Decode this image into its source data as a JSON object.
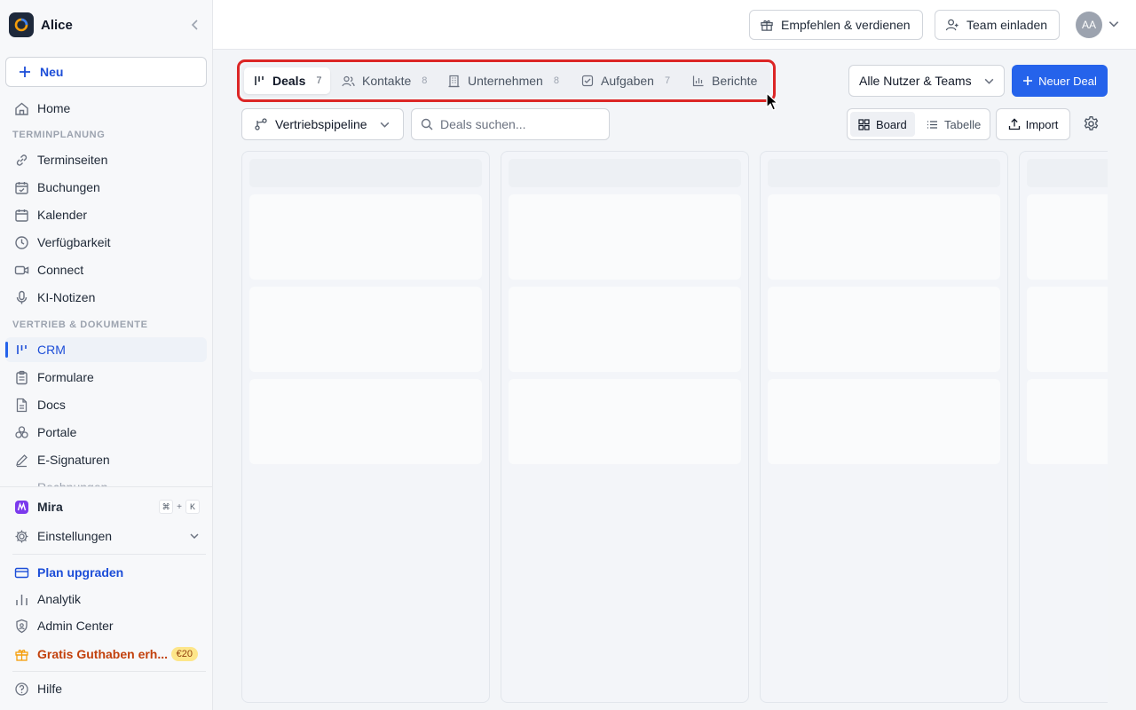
{
  "workspace": {
    "name": "Alice"
  },
  "sidebar": {
    "new_label": "Neu",
    "home": "Home",
    "section_scheduling": "TERMINPLANUNG",
    "scheduling_items": [
      "Terminseiten",
      "Buchungen",
      "Kalender",
      "Verfügbarkeit",
      "Connect",
      "KI-Notizen"
    ],
    "section_sales": "VERTRIEB & DOKUMENTE",
    "sales_items": [
      "CRM",
      "Formulare",
      "Docs",
      "Portale",
      "E-Signaturen"
    ],
    "cut_item": "Rechnungen",
    "mira": "Mira",
    "shortcut_cmd": "⌘",
    "shortcut_plus": "+",
    "shortcut_key": "K",
    "settings": "Einstellungen",
    "upgrade": "Plan upgraden",
    "analytics": "Analytik",
    "admin": "Admin Center",
    "credit": "Gratis Guthaben erh...",
    "credit_badge": "€20",
    "help": "Hilfe"
  },
  "topbar": {
    "refer": "Empfehlen & verdienen",
    "invite": "Team einladen",
    "avatar_initials": "AA"
  },
  "tabs": [
    {
      "label": "Deals",
      "count": "7"
    },
    {
      "label": "Kontakte",
      "count": "8"
    },
    {
      "label": "Unternehmen",
      "count": "8"
    },
    {
      "label": "Aufgaben",
      "count": "7"
    },
    {
      "label": "Berichte",
      "count": ""
    }
  ],
  "filters": {
    "users_teams": "Alle Nutzer & Teams",
    "new_deal": "Neuer Deal",
    "pipeline": "Vertriebspipeline",
    "search_placeholder": "Deals suchen...",
    "view_board": "Board",
    "view_table": "Tabelle",
    "import": "Import"
  },
  "colors": {
    "accent": "#2563eb",
    "highlight": "#dc2626",
    "credit": "#c2410c"
  },
  "board": {
    "columns_visible": 4,
    "cards_per_column": 3,
    "state": "loading"
  }
}
